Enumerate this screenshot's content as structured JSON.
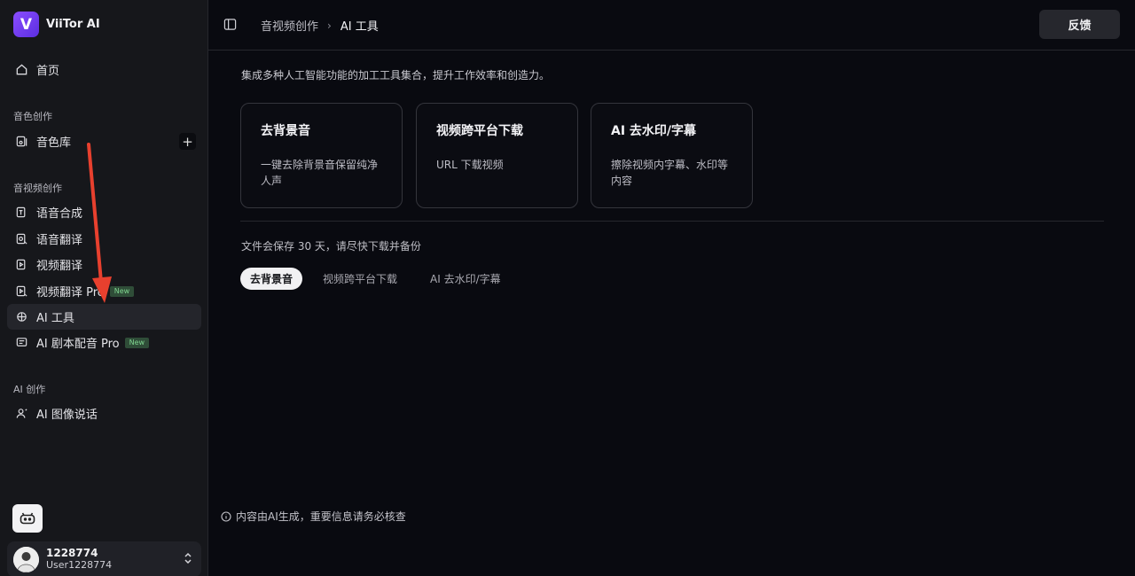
{
  "brand": {
    "name": "ViiTor AI",
    "logo_letter": "V"
  },
  "sidebar": {
    "home": {
      "label": "首页",
      "icon": "home-icon"
    },
    "sections": {
      "voice": "音色创作",
      "av": "音视频创作",
      "ai": "AI 创作"
    },
    "voice_library": {
      "label": "音色库",
      "icon": "library-icon",
      "add": "+"
    },
    "av_items": [
      {
        "label": "语音合成",
        "icon": "tts-icon"
      },
      {
        "label": "语音翻译",
        "icon": "voice-translate-icon"
      },
      {
        "label": "视频翻译",
        "icon": "video-translate-icon"
      },
      {
        "label": "视频翻译 Pro",
        "icon": "video-translate-pro-icon",
        "badge": "New"
      },
      {
        "label": "AI 工具",
        "icon": "ai-tools-icon",
        "active": true
      },
      {
        "label": "AI 剧本配音 Pro",
        "icon": "script-dub-icon",
        "badge": "New"
      }
    ],
    "ai_items": [
      {
        "label": "AI 图像说话",
        "icon": "image-talk-icon"
      }
    ]
  },
  "user": {
    "name": "1228774",
    "handle": "User1228774"
  },
  "topbar": {
    "breadcrumb": [
      "音视频创作",
      "AI 工具"
    ],
    "breadcrumb_sep": "›",
    "feedback_label": "反馈"
  },
  "main": {
    "intro": "集成多种人工智能功能的加工工具集合，提升工作效率和创造力。",
    "tools": [
      {
        "title": "去背景音",
        "desc": "一键去除背景音保留纯净人声"
      },
      {
        "title": "视频跨平台下载",
        "desc": "URL 下载视频"
      },
      {
        "title": "AI 去水印/字幕",
        "desc": "擦除视频内字幕、水印等内容"
      }
    ],
    "note": "文件会保存 30 天，请尽快下载并备份",
    "tabs": [
      "去背景音",
      "视频跨平台下载",
      "AI 去水印/字幕"
    ],
    "active_tab": 0,
    "disclaimer": "内容由AI生成，重要信息请务必核查"
  },
  "colors": {
    "accent": "#7c3aed",
    "badge_bg": "#2f4d38",
    "badge_text": "#7fd58f",
    "annotation_arrow": "#e8402e"
  }
}
